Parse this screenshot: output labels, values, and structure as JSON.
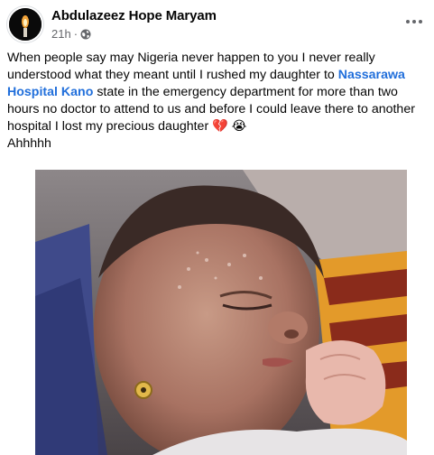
{
  "post": {
    "author": "Abdulazeez Hope Maryam",
    "time": "21h",
    "separator": "·",
    "privacy_icon": "globe-icon",
    "more_icon": "more-options-icon",
    "text_before_link": "When people say may Nigeria never happen to you I never really understood what they meant until I rushed my daughter to ",
    "link_text": "Nassarawa Hospital Kano",
    "text_after_link": " state in the emergency department for more than two hours no doctor to attend to us and before I could leave there to another hospital I lost my precious daughter ",
    "emoji_1": "💔",
    "emoji_2": "😭",
    "second_line": "Ahhhhh"
  },
  "colors": {
    "link": "#216fdb",
    "secondary_text": "#65676b",
    "primary_text": "#050505"
  }
}
